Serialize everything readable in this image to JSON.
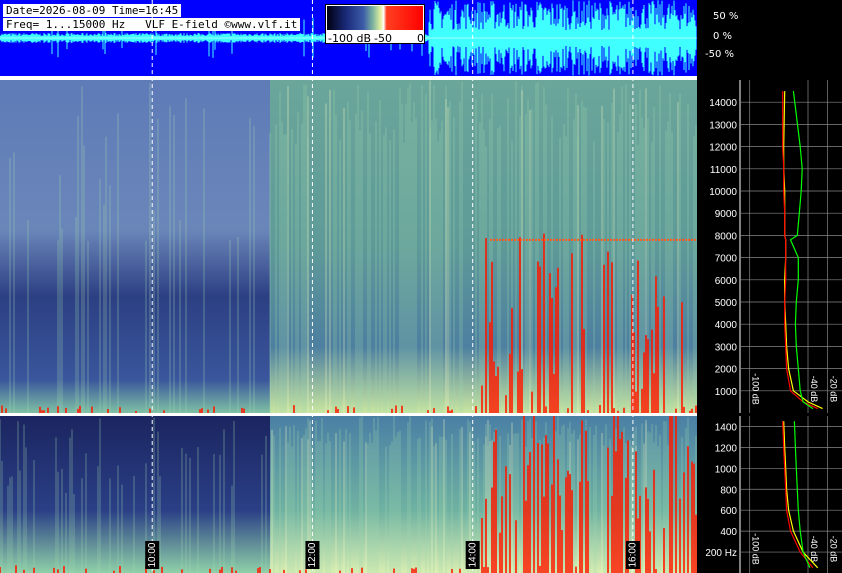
{
  "header": {
    "date_line": "Date=2026-08-09 Time=16:45",
    "freq_line": "Freq= 1...15000 Hz   VLF E-field ©www.vlf.it"
  },
  "colorbar": {
    "labels": [
      "-100 dB",
      "-50",
      "0"
    ],
    "colors": [
      "#000010",
      "#1a2a7a",
      "#3c5ca8",
      "#7fb6a0",
      "#e6f0a0",
      "#ffffff",
      "#ff0000"
    ]
  },
  "waveform": {
    "labels": [
      "50 %",
      "0 %",
      "-50 %"
    ],
    "background": "#0000ff",
    "color": "#40ffff"
  },
  "chart_data": [
    {
      "type": "heatmap",
      "panel": "spectrogram-full",
      "y_ticks": [
        1000,
        2000,
        3000,
        4000,
        5000,
        6000,
        7000,
        8000,
        9000,
        10000,
        11000,
        12000,
        13000,
        14000
      ],
      "ylim": [
        0,
        15000
      ],
      "x_ticks": [
        "10:00",
        "12:00",
        "14:00",
        "16:00"
      ],
      "x_hours": [
        10,
        12,
        14,
        16
      ],
      "xlim": [
        8.1,
        16.8
      ],
      "interference_line_hz": 7800,
      "grid": true
    },
    {
      "type": "heatmap",
      "panel": "spectrogram-low",
      "y_ticks": [
        200,
        400,
        600,
        800,
        1000,
        1200,
        1400
      ],
      "y_tick_labels": [
        "200 Hz",
        "400",
        "600",
        "800",
        "1000",
        "1200",
        "1400"
      ],
      "ylim": [
        0,
        1500
      ],
      "x_ticks": [
        "10:00",
        "12:00",
        "14:00",
        "16:00"
      ],
      "x_hours": [
        10,
        12,
        14,
        16
      ],
      "grid": true
    },
    {
      "type": "line",
      "panel": "spectrum-full",
      "x_tick_labels": [
        "-100 dB",
        "-40 dB",
        "-20 dB"
      ],
      "x_ticks": [
        -100,
        -40,
        -20
      ],
      "xlim": [
        -110,
        -5
      ],
      "series": [
        {
          "color": "#ffff00",
          "x": [
            -25,
            -40,
            -55,
            -60,
            -62,
            -63,
            -64,
            -64,
            -63,
            -63,
            -64,
            -64,
            -64,
            -65,
            -65,
            -64
          ],
          "y": [
            200,
            500,
            1000,
            2000,
            3000,
            4000,
            5000,
            6000,
            7000,
            7800,
            8000,
            9000,
            10000,
            11000,
            12000,
            14500
          ]
        },
        {
          "color": "#ff0000",
          "x": [
            -30,
            -45,
            -58,
            -62,
            -63,
            -64,
            -64,
            -63,
            -63,
            -63,
            -64,
            -64,
            -65,
            -65,
            -66,
            -66
          ],
          "y": [
            200,
            500,
            1000,
            2000,
            3000,
            4000,
            5000,
            6000,
            7000,
            7800,
            8000,
            9000,
            10000,
            11000,
            12000,
            14500
          ]
        },
        {
          "color": "#00ff00",
          "x": [
            -35,
            -45,
            -48,
            -50,
            -52,
            -53,
            -52,
            -50,
            -50,
            -58,
            -51,
            -49,
            -47,
            -46,
            -48,
            -55
          ],
          "y": [
            200,
            500,
            1000,
            2000,
            3000,
            4000,
            5000,
            6000,
            7000,
            7800,
            8000,
            9000,
            10000,
            11000,
            12000,
            14500
          ]
        }
      ]
    },
    {
      "type": "line",
      "panel": "spectrum-low",
      "x_tick_labels": [
        "-100 dB",
        "-40 dB",
        "-20 dB"
      ],
      "x_ticks": [
        -100,
        -40,
        -20
      ],
      "xlim": [
        -110,
        -5
      ],
      "series": [
        {
          "color": "#ffff00",
          "x": [
            -30,
            -45,
            -55,
            -60,
            -62,
            -63,
            -64,
            -65
          ],
          "y": [
            50,
            200,
            400,
            600,
            800,
            1000,
            1200,
            1450
          ]
        },
        {
          "color": "#ff0000",
          "x": [
            -35,
            -48,
            -58,
            -62,
            -63,
            -64,
            -65,
            -66
          ],
          "y": [
            50,
            200,
            400,
            600,
            800,
            1000,
            1200,
            1450
          ]
        },
        {
          "color": "#00ff00",
          "x": [
            -38,
            -45,
            -48,
            -50,
            -51,
            -52,
            -53,
            -54
          ],
          "y": [
            50,
            200,
            400,
            600,
            800,
            1000,
            1200,
            1450
          ]
        }
      ]
    }
  ]
}
